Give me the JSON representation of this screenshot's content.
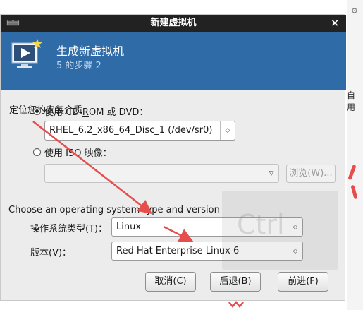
{
  "window": {
    "title": "新建虚拟机",
    "close_glyph": "×"
  },
  "banner": {
    "title": "生成新虚拟机",
    "step": "5 的步骤 2"
  },
  "install_media": {
    "section_label": "定位您的安装介质",
    "cdrom_label_prefix": "使用 CD-",
    "cdrom_label_accel": "R",
    "cdrom_label_suffix": "OM 或 DVD：",
    "cdrom_selected": "RHEL_6.2_x86_64_Disc_1 (/dev/sr0)",
    "iso_label_prefix": "使用 ",
    "iso_label_accel": "I",
    "iso_label_suffix": "SO 映像：",
    "iso_value": "",
    "browse_button": "浏览(W)..."
  },
  "os_section": {
    "heading": "Choose an operating system type and version",
    "type_label": "操作系统类型(T)：",
    "type_value": "Linux",
    "version_label": "版本(V)：",
    "version_value": "Red Hat Enterprise Linux 6"
  },
  "buttons": {
    "cancel": "取消(C)",
    "back": "后退(B)",
    "forward": "前进(F)"
  },
  "background": {
    "watermark": "Ctrl",
    "peek_text": "自用"
  },
  "colors": {
    "banner": "#2f6ba7",
    "titlebar": "#222222",
    "arrow": "#e64d4d"
  }
}
